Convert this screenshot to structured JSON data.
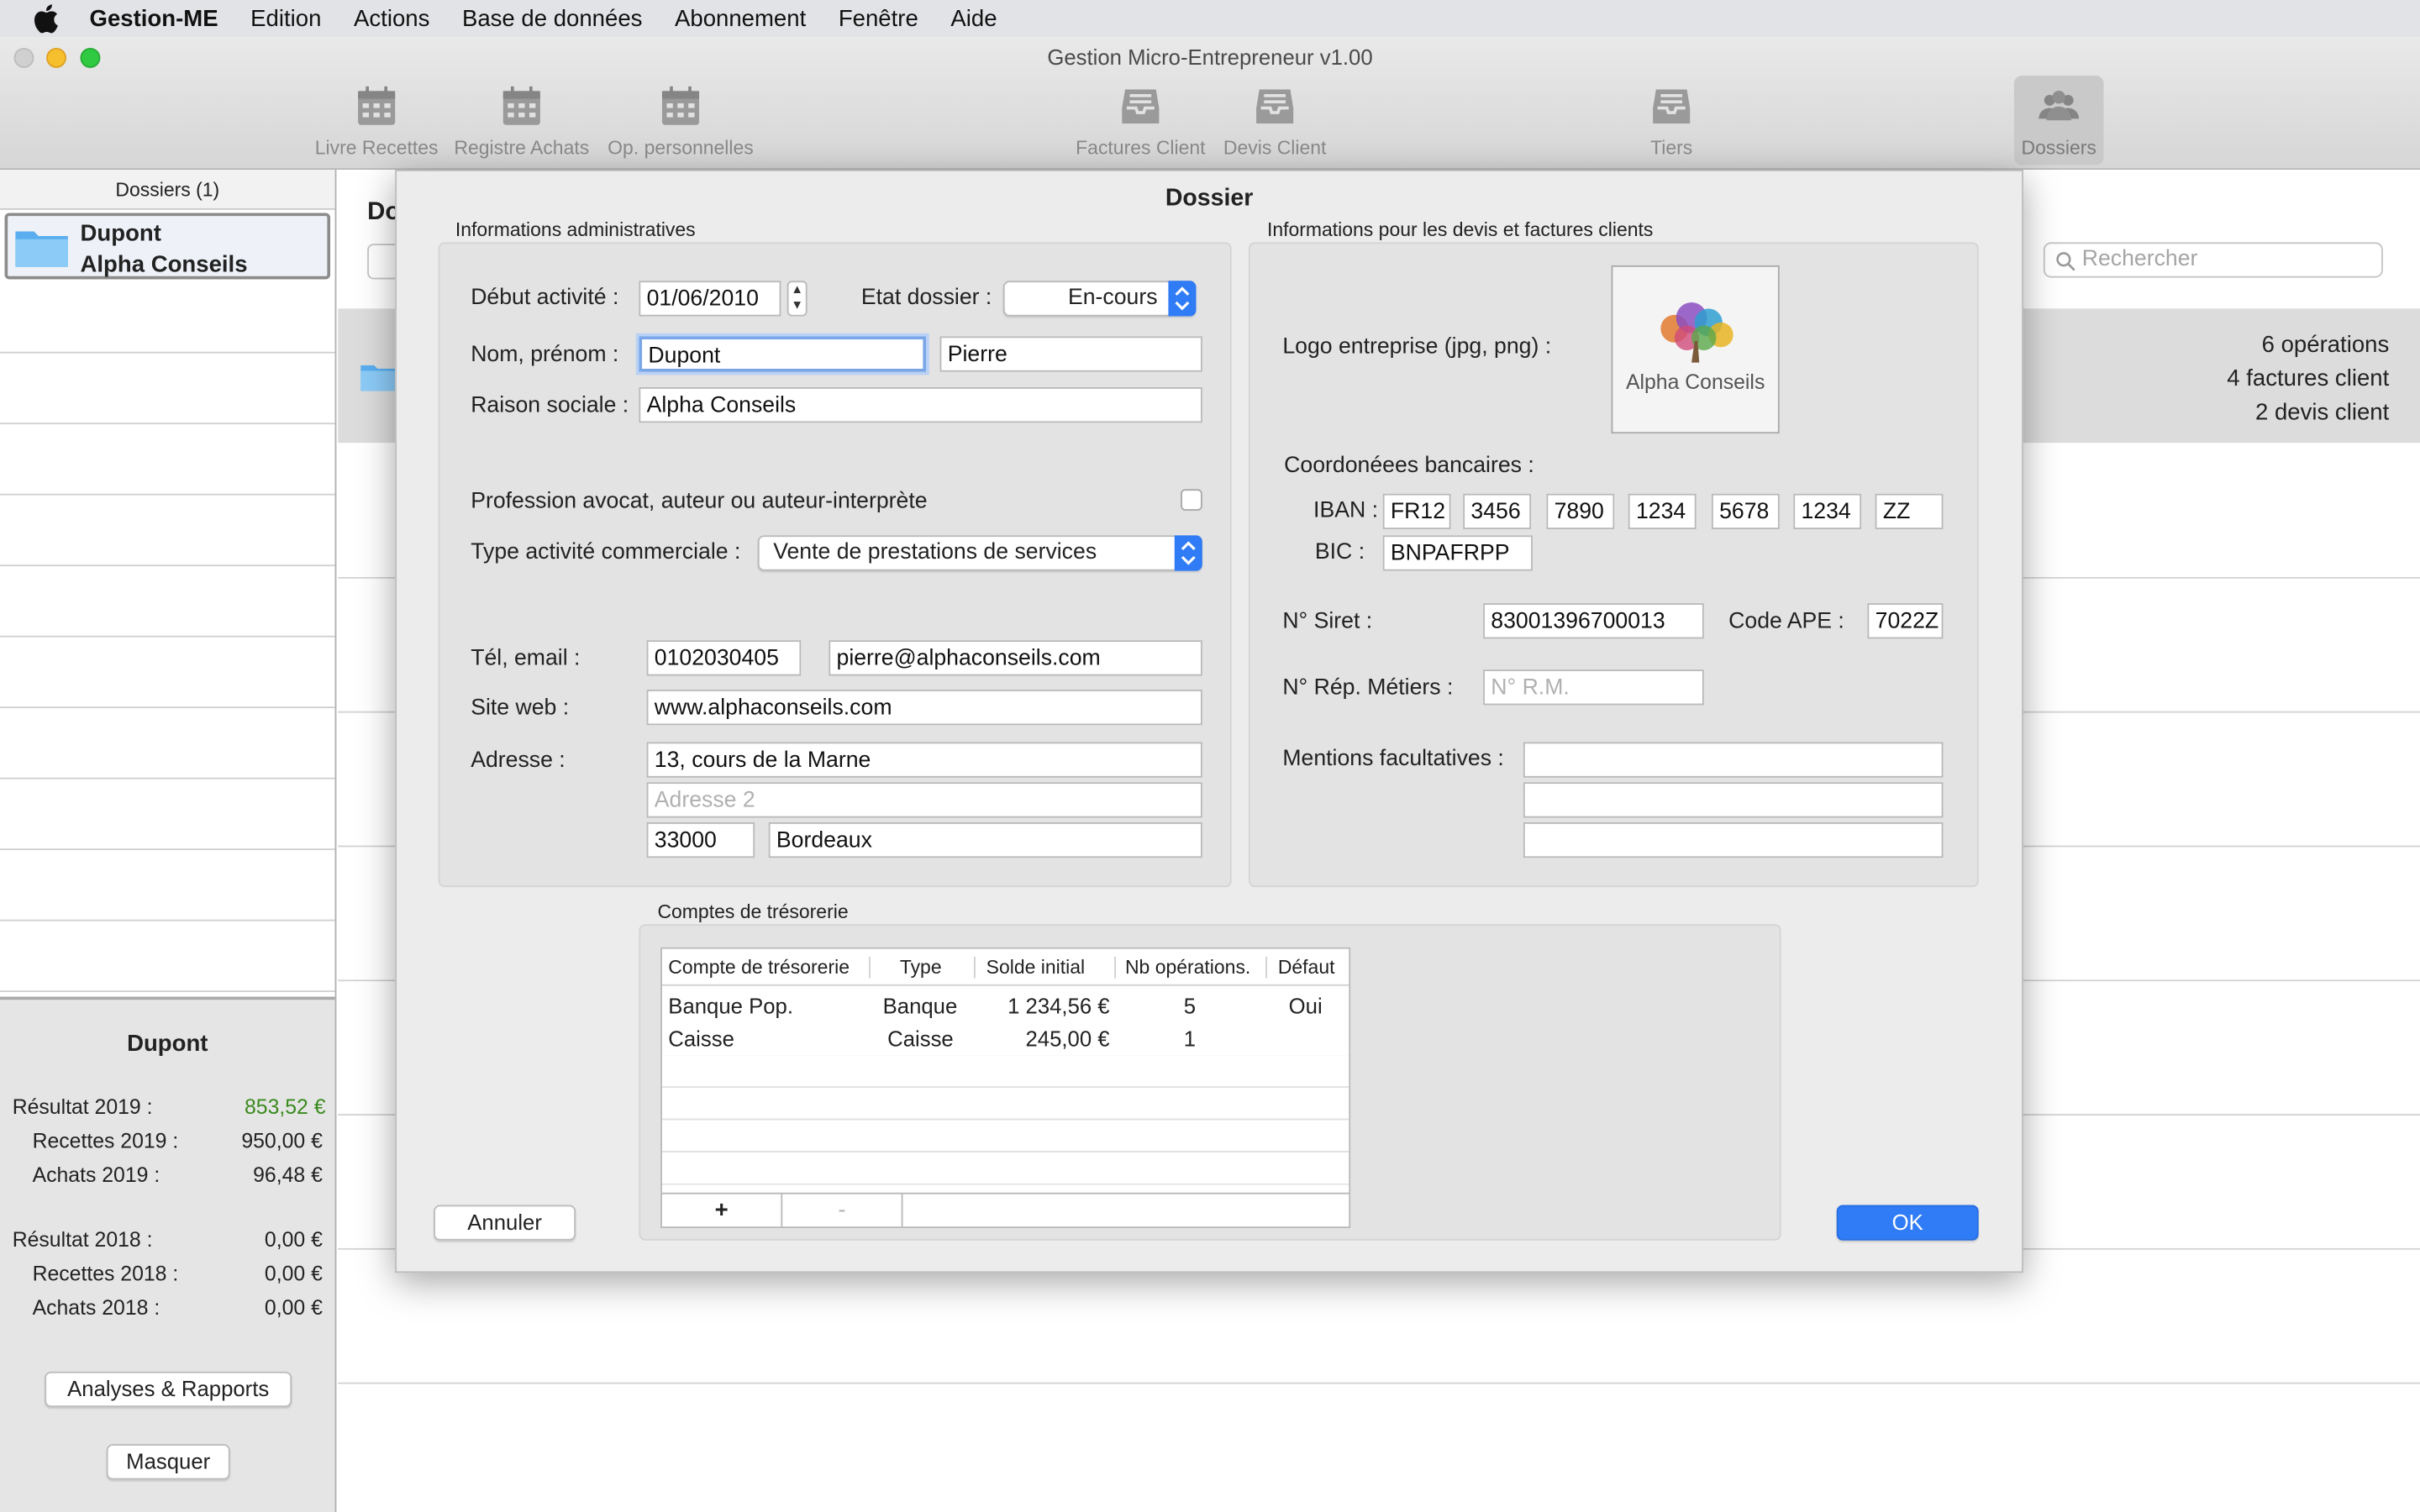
{
  "menubar": {
    "app_name": "Gestion-ME",
    "items": [
      "Edition",
      "Actions",
      "Base de données",
      "Abonnement",
      "Fenêtre",
      "Aide"
    ]
  },
  "window": {
    "title": "Gestion Micro-Entrepreneur v1.00"
  },
  "toolbar": {
    "livre_recettes": "Livre Recettes",
    "registre_achats": "Registre Achats",
    "op_personnelles": "Op. personnelles",
    "factures_client": "Factures Client",
    "devis_client": "Devis Client",
    "tiers": "Tiers",
    "dossiers": "Dossiers"
  },
  "sidebar": {
    "header": "Dossiers (1)",
    "selected_item": {
      "line1": "Dupont",
      "line2": "Alpha Conseils"
    },
    "summary": {
      "name": "Dupont",
      "rows": [
        {
          "label": "Résultat 2019 :",
          "value": "853,52 €"
        },
        {
          "label": "Recettes 2019 :",
          "value": "950,00 €"
        },
        {
          "label": "Achats 2019 :",
          "value": "96,48 €"
        },
        {
          "label": "Résultat 2018 :",
          "value": "0,00 €"
        },
        {
          "label": "Recettes 2018 :",
          "value": "0,00 €"
        },
        {
          "label": "Achats 2018 :",
          "value": "0,00 €"
        }
      ],
      "result_positive_color": "#3a8a1e",
      "analyses_button": "Analyses & Rapports",
      "masquer_button": "Masquer"
    }
  },
  "main": {
    "header_partial": "Do",
    "search_placeholder": "Rechercher",
    "stats": [
      "6 opérations",
      "4 factures client",
      "2 devis client"
    ]
  },
  "dialog": {
    "title": "Dossier",
    "admin": {
      "section_title": "Informations administratives",
      "debut_label": "Début activité :",
      "debut_value": "01/06/2010",
      "etat_label": "Etat dossier :",
      "etat_value": "En-cours",
      "nom_label": "Nom, prénom :",
      "nom_value": "Dupont",
      "prenom_value": "Pierre",
      "raison_label": "Raison sociale :",
      "raison_value": "Alpha Conseils",
      "profession_label": "Profession avocat, auteur ou auteur-interprète",
      "type_label": "Type activité commerciale :",
      "type_value": "Vente de prestations de services",
      "tel_label": "Tél, email :",
      "tel_value": "0102030405",
      "email_value": "pierre@alphaconseils.com",
      "site_label": "Site web :",
      "site_value": "www.alphaconseils.com",
      "adresse_label": "Adresse :",
      "adresse1_value": "13, cours de la Marne",
      "adresse2_placeholder": "Adresse 2",
      "cp_value": "33000",
      "ville_value": "Bordeaux"
    },
    "clients": {
      "section_title": "Informations pour les devis et factures clients",
      "logo_label": "Logo entreprise (jpg, png) :",
      "logo_text": "Alpha Conseils",
      "bank_label": "Coordonéees bancaires :",
      "iban_label": "IBAN :",
      "iban_parts": [
        "FR12",
        "3456",
        "7890",
        "1234",
        "5678",
        "1234",
        "ZZ"
      ],
      "bic_label": "BIC :",
      "bic_value": "BNPAFRPP",
      "siret_label": "N° Siret :",
      "siret_value": "83001396700013",
      "ape_label": "Code APE :",
      "ape_value": "7022Z",
      "rm_label": "N° Rép. Métiers :",
      "rm_placeholder": "N° R.M.",
      "mentions_label": "Mentions facultatives :"
    },
    "tresorerie": {
      "section_title": "Comptes de trésorerie",
      "columns": [
        "Compte de trésorerie",
        "Type",
        "Solde initial",
        "Nb opérations.",
        "Défaut"
      ],
      "rows": [
        [
          "Banque Pop.",
          "Banque",
          "1 234,56 €",
          "5",
          "Oui"
        ],
        [
          "Caisse",
          "Caisse",
          "245,00 €",
          "1",
          ""
        ]
      ],
      "add_label": "+",
      "remove_label": "-"
    },
    "cancel_button": "Annuler",
    "ok_button": "OK",
    "accent_color": "#2f7cf6"
  }
}
